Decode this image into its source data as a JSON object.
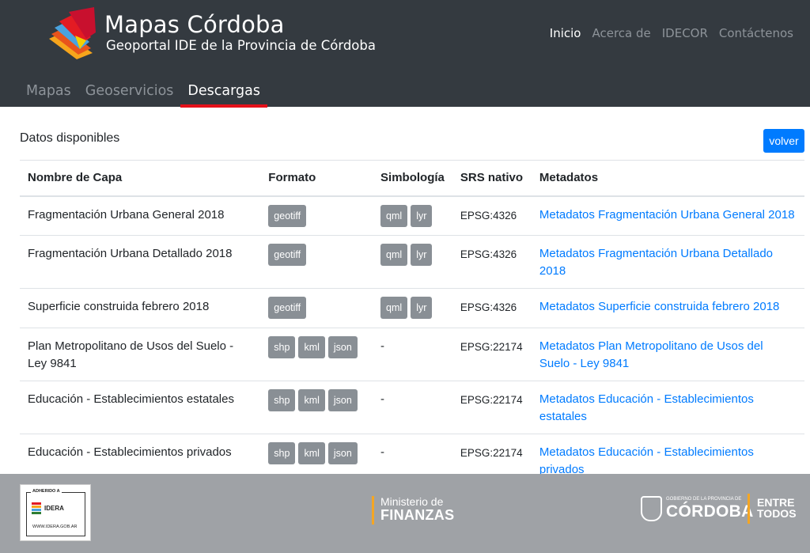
{
  "header": {
    "title": "Mapas Córdoba",
    "subtitle": "Geoportal IDE de la Provincia de Córdoba",
    "topnav": [
      {
        "label": "Inicio",
        "active": true
      },
      {
        "label": "Acerca de",
        "active": false
      },
      {
        "label": "IDECOR",
        "active": false
      },
      {
        "label": "Contáctenos",
        "active": false
      }
    ],
    "subnav": [
      {
        "label": "Mapas",
        "active": false
      },
      {
        "label": "Geoservicios",
        "active": false
      },
      {
        "label": "Descargas",
        "active": true
      }
    ]
  },
  "main": {
    "section_title": "Datos disponibles",
    "back_button": "volver",
    "columns": [
      "Nombre de Capa",
      "Formato",
      "Simbología",
      "SRS nativo",
      "Metadatos"
    ],
    "rows": [
      {
        "name": "Fragmentación Urbana General 2018",
        "formats": [
          "geotiff"
        ],
        "symbology": [
          "qml",
          "lyr"
        ],
        "srs": "EPSG:4326",
        "metadata": "Metadatos Fragmentación Urbana General 2018"
      },
      {
        "name": "Fragmentación Urbana Detallado 2018",
        "formats": [
          "geotiff"
        ],
        "symbology": [
          "qml",
          "lyr"
        ],
        "srs": "EPSG:4326",
        "metadata": "Metadatos Fragmentación Urbana Detallado 2018"
      },
      {
        "name": "Superficie construida febrero 2018",
        "formats": [
          "geotiff"
        ],
        "symbology": [
          "qml",
          "lyr"
        ],
        "srs": "EPSG:4326",
        "metadata": "Metadatos Superficie construida febrero 2018"
      },
      {
        "name": "Plan Metropolitano de Usos del Suelo - Ley 9841",
        "formats": [
          "shp",
          "kml",
          "json"
        ],
        "symbology": [],
        "symbology_empty": "-",
        "srs": "EPSG:22174",
        "metadata": "Metadatos Plan Metropolitano de Usos del Suelo - Ley 9841"
      },
      {
        "name": "Educación - Establecimientos estatales",
        "formats": [
          "shp",
          "kml",
          "json"
        ],
        "symbology": [],
        "symbology_empty": "-",
        "srs": "EPSG:22174",
        "metadata": "Metadatos Educación - Establecimientos estatales"
      },
      {
        "name": "Educación - Establecimientos privados",
        "formats": [
          "shp",
          "kml",
          "json"
        ],
        "symbology": [],
        "symbology_empty": "-",
        "srs": "EPSG:22174",
        "metadata": "Metadatos Educación - Establecimientos privados"
      }
    ]
  },
  "footer": {
    "idera": {
      "adherido": "ADHERIDO A",
      "name": "IDERA",
      "url": "WWW.IDERA.GOB.AR"
    },
    "ministerio": {
      "line1": "Ministerio de",
      "line2": "FINANZAS"
    },
    "gobierno": {
      "line1": "GOBIERNO DE LA PROVINCIA DE",
      "line2": "CÓRDOBA",
      "slogan1": "ENTRE",
      "slogan2": "TODOS"
    }
  },
  "colors": {
    "header_bg": "#343a40",
    "accent_red": "#e4101a",
    "link": "#007bff",
    "badge": "#898f95",
    "footer_bg": "#9fa2a6",
    "footer_accent": "#f5a623"
  }
}
